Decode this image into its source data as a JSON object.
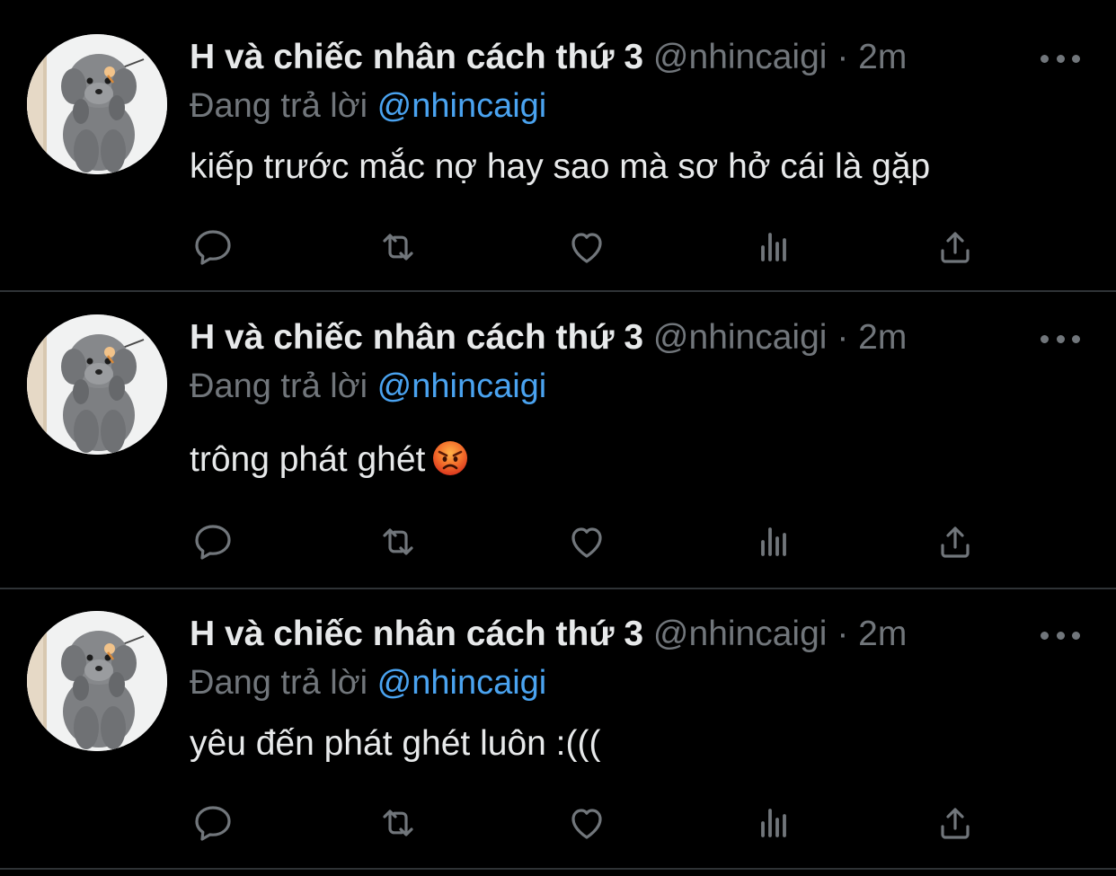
{
  "colors": {
    "background": "#000000",
    "divider": "#2f3336",
    "primary_text": "#e7e9ea",
    "secondary_text": "#71767b",
    "link": "#4aa3f0"
  },
  "tweets": [
    {
      "display_name": "H và chiếc nhân cách thứ 3",
      "handle": "@nhincaigi",
      "separator": "·",
      "time": "2m",
      "reply_prefix": "Đang trả lời",
      "reply_handle": "@nhincaigi",
      "text": "kiếp trước mắc nợ hay sao mà sơ hở cái là gặp",
      "emoji": null
    },
    {
      "display_name": "H và chiếc nhân cách thứ 3",
      "handle": "@nhincaigi",
      "separator": "·",
      "time": "2m",
      "reply_prefix": "Đang trả lời",
      "reply_handle": "@nhincaigi",
      "text": "trông phát ghét",
      "emoji": "angry-face-emoji"
    },
    {
      "display_name": "H và chiếc nhân cách thứ 3",
      "handle": "@nhincaigi",
      "separator": "·",
      "time": "2m",
      "reply_prefix": "Đang trả lời",
      "reply_handle": "@nhincaigi",
      "text": "yêu đến phát ghét luôn :(((",
      "emoji": null
    }
  ],
  "actions": [
    "reply-icon",
    "retweet-icon",
    "like-icon",
    "analytics-icon",
    "share-icon"
  ]
}
